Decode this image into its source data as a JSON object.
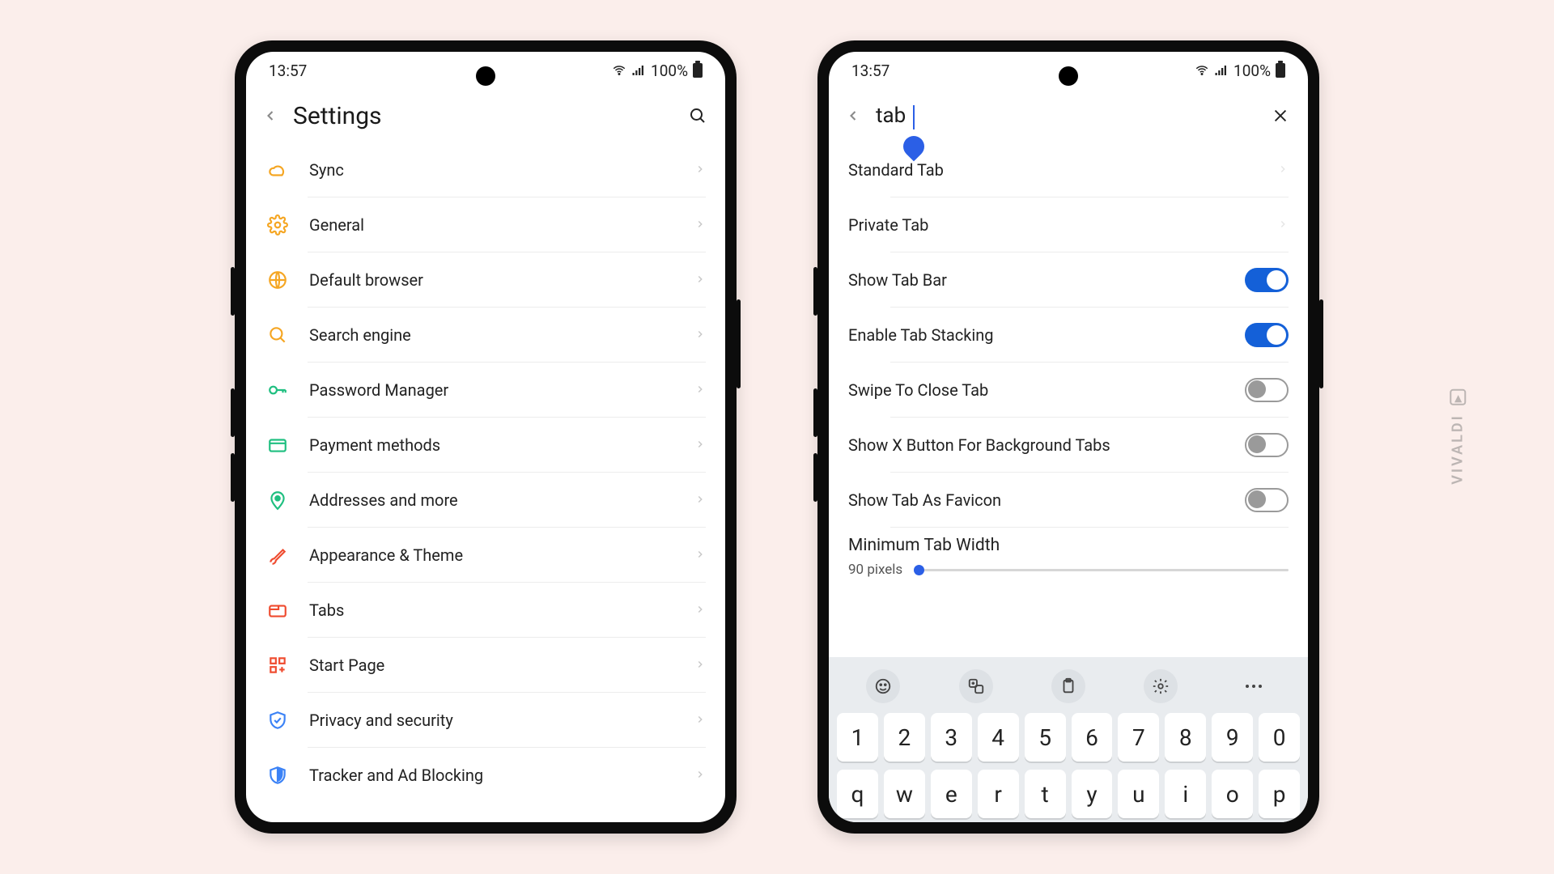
{
  "status": {
    "time": "13:57",
    "battery": "100%"
  },
  "left": {
    "title": "Settings",
    "items": [
      {
        "label": "Sync"
      },
      {
        "label": "General"
      },
      {
        "label": "Default browser"
      },
      {
        "label": "Search engine"
      },
      {
        "label": "Password Manager"
      },
      {
        "label": "Payment methods"
      },
      {
        "label": "Addresses and more"
      },
      {
        "label": "Appearance & Theme"
      },
      {
        "label": "Tabs"
      },
      {
        "label": "Start Page"
      },
      {
        "label": "Privacy and security"
      },
      {
        "label": "Tracker and Ad Blocking"
      }
    ]
  },
  "right": {
    "search_value": "tab",
    "items": [
      {
        "label": "Standard Tab"
      },
      {
        "label": "Private Tab"
      },
      {
        "label": "Show Tab Bar"
      },
      {
        "label": "Enable Tab Stacking"
      },
      {
        "label": "Swipe To Close Tab"
      },
      {
        "label": "Show X Button For Background Tabs"
      },
      {
        "label": "Show Tab As Favicon"
      }
    ],
    "slider": {
      "title": "Minimum Tab Width",
      "value": "90 pixels"
    }
  },
  "keyboard": {
    "row1": [
      "1",
      "2",
      "3",
      "4",
      "5",
      "6",
      "7",
      "8",
      "9",
      "0"
    ],
    "row2": [
      "q",
      "w",
      "e",
      "r",
      "t",
      "y",
      "u",
      "i",
      "o",
      "p"
    ]
  },
  "brand": "VIVALDI"
}
